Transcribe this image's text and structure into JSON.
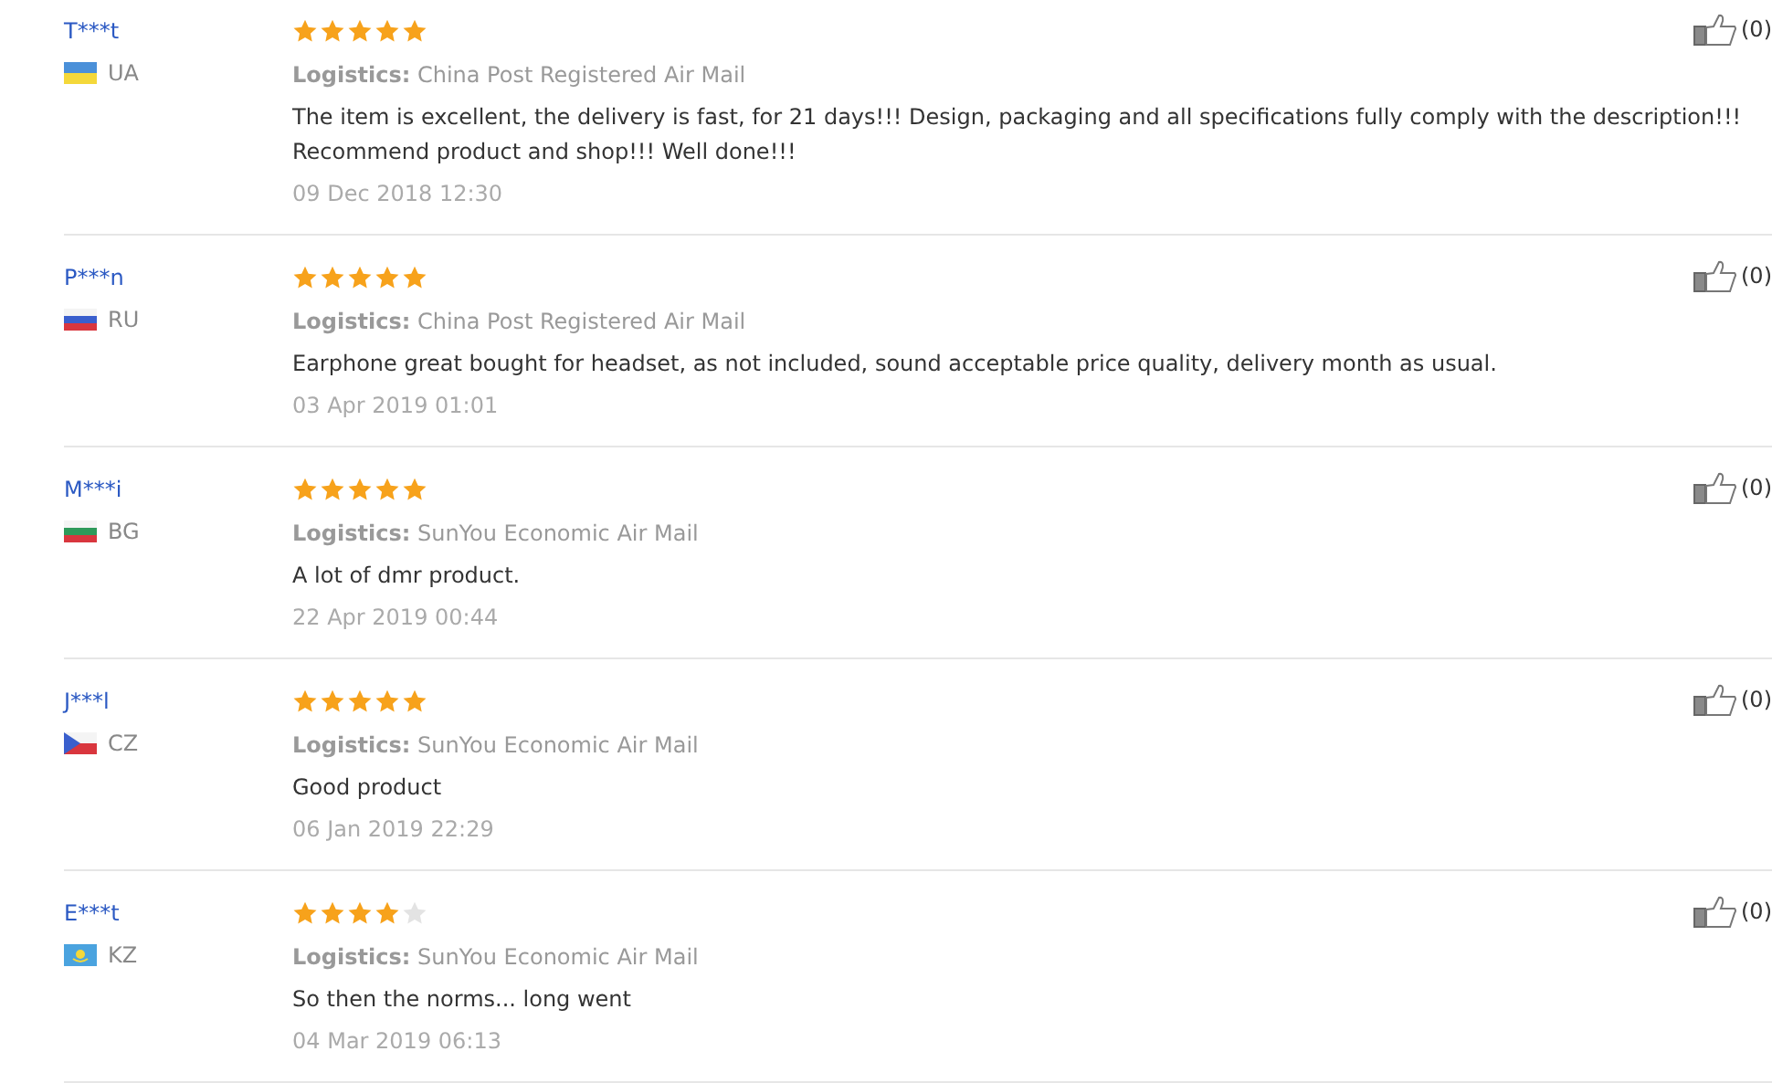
{
  "reviews": [
    {
      "user": "T***t",
      "country": "UA",
      "flag": {
        "kind": "ukraine"
      },
      "stars": 5,
      "logistics_label": "Logistics:",
      "logistics": "China Post Registered Air Mail",
      "text": "The item is excellent, the delivery is fast, for 21 days!!! Design, packaging and all specifications fully comply with the description!!! Recommend product and shop!!! Well done!!!",
      "date": "09 Dec 2018 12:30",
      "helpful": "(0)"
    },
    {
      "user": "P***n",
      "country": "RU",
      "flag": {
        "kind": "russia"
      },
      "stars": 5,
      "logistics_label": "Logistics:",
      "logistics": "China Post Registered Air Mail",
      "text": "Earphone great bought for headset, as not included, sound acceptable price quality, delivery month as usual.",
      "date": "03 Apr 2019 01:01",
      "helpful": "(0)"
    },
    {
      "user": "M***i",
      "country": "BG",
      "flag": {
        "kind": "bulgaria"
      },
      "stars": 5,
      "logistics_label": "Logistics:",
      "logistics": "SunYou Economic Air Mail",
      "text": "A lot of dmr product.",
      "date": "22 Apr 2019 00:44",
      "helpful": "(0)"
    },
    {
      "user": "J***l",
      "country": "CZ",
      "flag": {
        "kind": "czechia"
      },
      "stars": 5,
      "logistics_label": "Logistics:",
      "logistics": "SunYou Economic Air Mail",
      "text": "Good product",
      "date": "06 Jan 2019 22:29",
      "helpful": "(0)"
    },
    {
      "user": "E***t",
      "country": "KZ",
      "flag": {
        "kind": "kazakhstan"
      },
      "stars": 4,
      "logistics_label": "Logistics:",
      "logistics": "SunYou Economic Air Mail",
      "text": "So then the norms... long went",
      "date": "04 Mar 2019 06:13",
      "helpful": "(0)"
    }
  ]
}
